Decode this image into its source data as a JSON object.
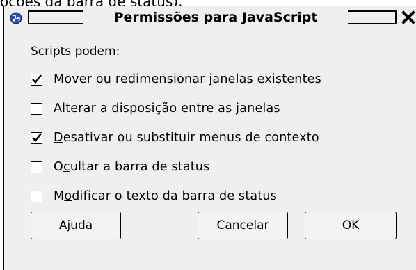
{
  "background": {
    "clipped_text": "oções da barra de status)."
  },
  "dialog": {
    "title": "Permissões para JavaScript",
    "app_icon": "globe-app-icon",
    "close_icon": "close-x-icon"
  },
  "main": {
    "prompt": "Scripts podem:",
    "options": [
      {
        "mnemonic": "M",
        "rest": "over ou redimensionar janelas existentes",
        "prefix": "",
        "checked": true
      },
      {
        "mnemonic": "A",
        "rest": "lterar a disposição entre as janelas",
        "prefix": "",
        "checked": false
      },
      {
        "mnemonic": "D",
        "rest": "esativar ou substituir menus de contexto",
        "prefix": "",
        "checked": true
      },
      {
        "mnemonic": "c",
        "rest": "ultar a barra de status",
        "prefix": "O",
        "checked": false
      },
      {
        "mnemonic": "o",
        "rest": "dificar o texto da barra de status",
        "prefix": "M",
        "checked": false
      }
    ]
  },
  "buttons": {
    "help": "Ajuda",
    "cancel": "Cancelar",
    "ok": "OK"
  },
  "colors": {
    "dialog_bg": "#efefef",
    "text": "#000000",
    "icon_blue": "#2a4fb5"
  }
}
